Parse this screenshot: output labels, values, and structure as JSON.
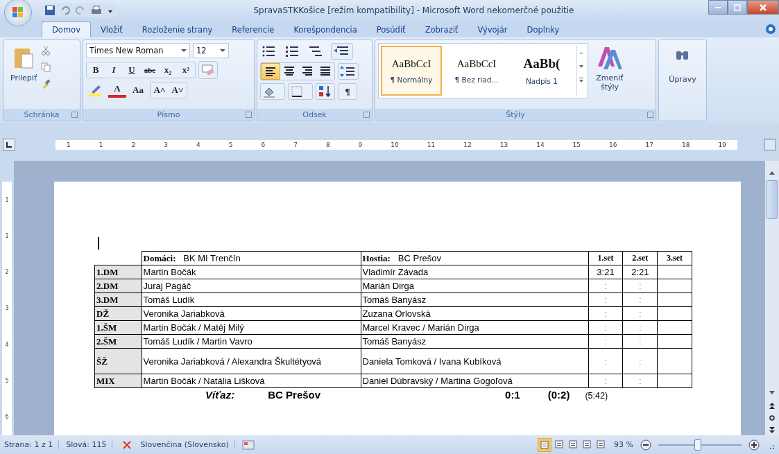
{
  "window": {
    "title": "SpravaSTKKošice [režim kompatibility] - Microsoft Word nekomerčné použitie"
  },
  "tabs": [
    {
      "label": "Domov",
      "selected": true
    },
    {
      "label": "Vložiť",
      "selected": false
    },
    {
      "label": "Rozloženie strany",
      "selected": false
    },
    {
      "label": "Referencie",
      "selected": false
    },
    {
      "label": "Korešpondencia",
      "selected": false
    },
    {
      "label": "Posúdiť",
      "selected": false
    },
    {
      "label": "Zobraziť",
      "selected": false
    },
    {
      "label": "Vývojár",
      "selected": false
    },
    {
      "label": "Doplnky",
      "selected": false
    }
  ],
  "ribbon": {
    "clipboard": {
      "label": "Schránka",
      "paste": "Prilepiť"
    },
    "font": {
      "label": "Písmo",
      "font_name": "Times New Roman",
      "font_size": "12",
      "format_buttons": [
        "B",
        "I",
        "U",
        "abc",
        "x₂",
        "x²"
      ],
      "color_button": "A",
      "case_button": "Aa",
      "grow_buttons": [
        "A˄",
        "A˅"
      ]
    },
    "paragraph": {
      "label": "Odsek",
      "alignments": [
        {
          "selected": true
        },
        {
          "selected": false
        },
        {
          "selected": false
        },
        {
          "selected": false
        }
      ],
      "pilcrow": "¶"
    },
    "styles": {
      "label": "Štýly",
      "items": [
        {
          "preview": "AaBbCcI",
          "name": "¶ Normálny",
          "selected": true,
          "kind": "normal"
        },
        {
          "preview": "AaBbCcI",
          "name": "¶ Bez riad...",
          "selected": false,
          "kind": "normal"
        },
        {
          "preview": "AaBb(",
          "name": "Nadpis 1",
          "selected": false,
          "kind": "heading"
        }
      ],
      "change": "Zmeniť štýly"
    },
    "editing": {
      "label": "Úpravy"
    }
  },
  "ruler": {
    "labels": [
      "1",
      "1",
      "2",
      "3",
      "4",
      "5",
      "6",
      "7",
      "8",
      "9",
      "10",
      "11",
      "12",
      "13",
      "14",
      "15",
      "16",
      "17",
      "18",
      "19"
    ],
    "vertical_labels": [
      "1",
      "1",
      "2",
      "3",
      "4",
      "5",
      "6"
    ]
  },
  "document": {
    "table": {
      "home_label": "Domáci:",
      "home": "BK MI Trenčín",
      "guest_label": "Hostia:",
      "guest": "BC Prešov",
      "sets": [
        "1.set",
        "2.set",
        "3.set"
      ],
      "rows": [
        {
          "code": "1.DM",
          "home": "Martin Bočák",
          "guest": "Vladimír Závada",
          "scores": [
            "3:21",
            "2:21"
          ]
        },
        {
          "code": "2.DM",
          "home": "Juraj Pagáč",
          "guest": "Marián Dirga",
          "scores": [
            ":",
            ":"
          ]
        },
        {
          "code": "3.DM",
          "home": "Tomáš Ludík",
          "guest": "Tomáš Banyász",
          "scores": [
            ":",
            ":"
          ]
        },
        {
          "code": "DŽ",
          "home": "Veronika Jariabková",
          "guest": "Zuzana Orlovská",
          "scores": [
            ":",
            ":"
          ]
        },
        {
          "code": "1.ŠM",
          "home": "Martin Bočák / Matěj Milý",
          "guest": "Marcel Kravec / Marián Dirga",
          "scores": [
            ":",
            ":"
          ]
        },
        {
          "code": "2.ŠM",
          "home": "Tomáš Ludík / Martin Vavro",
          "guest": "Tomáš Banyász",
          "scores": [
            ":",
            ":"
          ]
        },
        {
          "code": "ŠŽ",
          "home": "Veronika Jariabková / Alexandra Škultétyová",
          "guest": "Daniela Tomková / Ivana Kubíková",
          "scores": [
            ":",
            ":"
          ]
        },
        {
          "code": "MIX",
          "home": "Martin Bočák / Natália Lišková",
          "guest": "Daniel Dúbravský / Martina Gogoľová",
          "scores": [
            ":",
            ":"
          ]
        }
      ]
    },
    "winner": {
      "label": "Víťaz:",
      "team": "BC Prešov",
      "score": "0:1",
      "sets": "(0:2)",
      "points": "(5:42)"
    }
  },
  "status_bar": {
    "page": "Strana: 1 z 1",
    "words": "Slová: 115",
    "language": "Slovenčina (Slovensko)",
    "views": [
      {
        "selected": true
      },
      {
        "selected": false
      },
      {
        "selected": false
      },
      {
        "selected": false
      },
      {
        "selected": false
      }
    ],
    "zoom": "93 %",
    "zoom_slider": {
      "level": 0.47
    }
  }
}
